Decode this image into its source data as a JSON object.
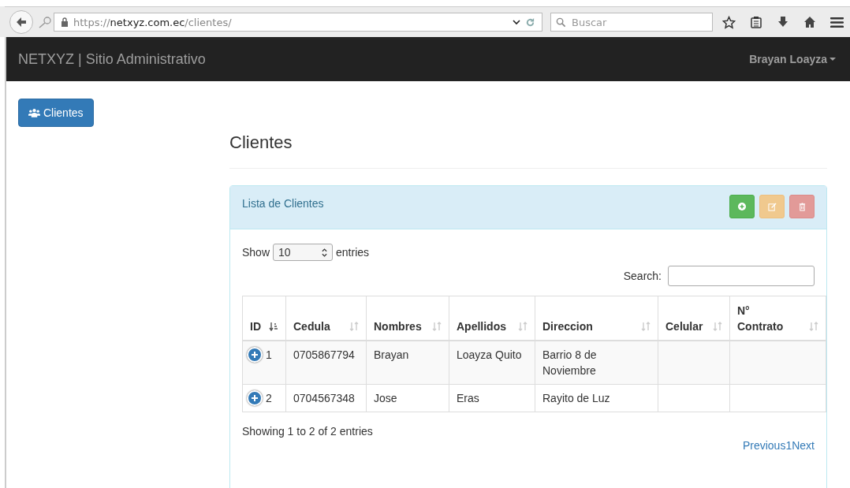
{
  "browser": {
    "url_scheme": "https://",
    "url_host": "netxyz.com.ec",
    "url_path": "/clientes/",
    "search_placeholder": "Buscar"
  },
  "navbar": {
    "brand": "NETXYZ | Sitio Administrativo",
    "user": "Brayan Loayza"
  },
  "sidebar": {
    "button": "Clientes"
  },
  "page_title": "Clientes",
  "panel": {
    "title": "Lista de Clientes",
    "actions": [
      {
        "kind": "add"
      },
      {
        "kind": "edit"
      },
      {
        "kind": "delete"
      }
    ],
    "length": {
      "label_before": "Show",
      "value": "10",
      "label_after": "entries"
    },
    "search": {
      "label": "Search:"
    },
    "table": {
      "columns": [
        {
          "label": "ID",
          "sorted": true
        },
        {
          "label": "Cedula",
          "sorted": false
        },
        {
          "label": "Nombres",
          "sorted": false
        },
        {
          "label": "Apellidos",
          "sorted": false
        },
        {
          "label": "Direccion",
          "sorted": false
        },
        {
          "label": "Celular",
          "sorted": false
        },
        {
          "label": "N° Contrato",
          "sorted": false
        }
      ],
      "rows": [
        [
          "1",
          "0705867794",
          "Brayan",
          "Loayza Quito",
          "Barrio 8 de Noviembre",
          "",
          ""
        ],
        [
          "2",
          "0704567348",
          "Jose",
          "Eras",
          "Rayito de Luz",
          "",
          ""
        ]
      ]
    },
    "info": "Showing 1 to 2 of 2 entries",
    "pagination": [
      "Previous",
      "1",
      "Next"
    ]
  }
}
